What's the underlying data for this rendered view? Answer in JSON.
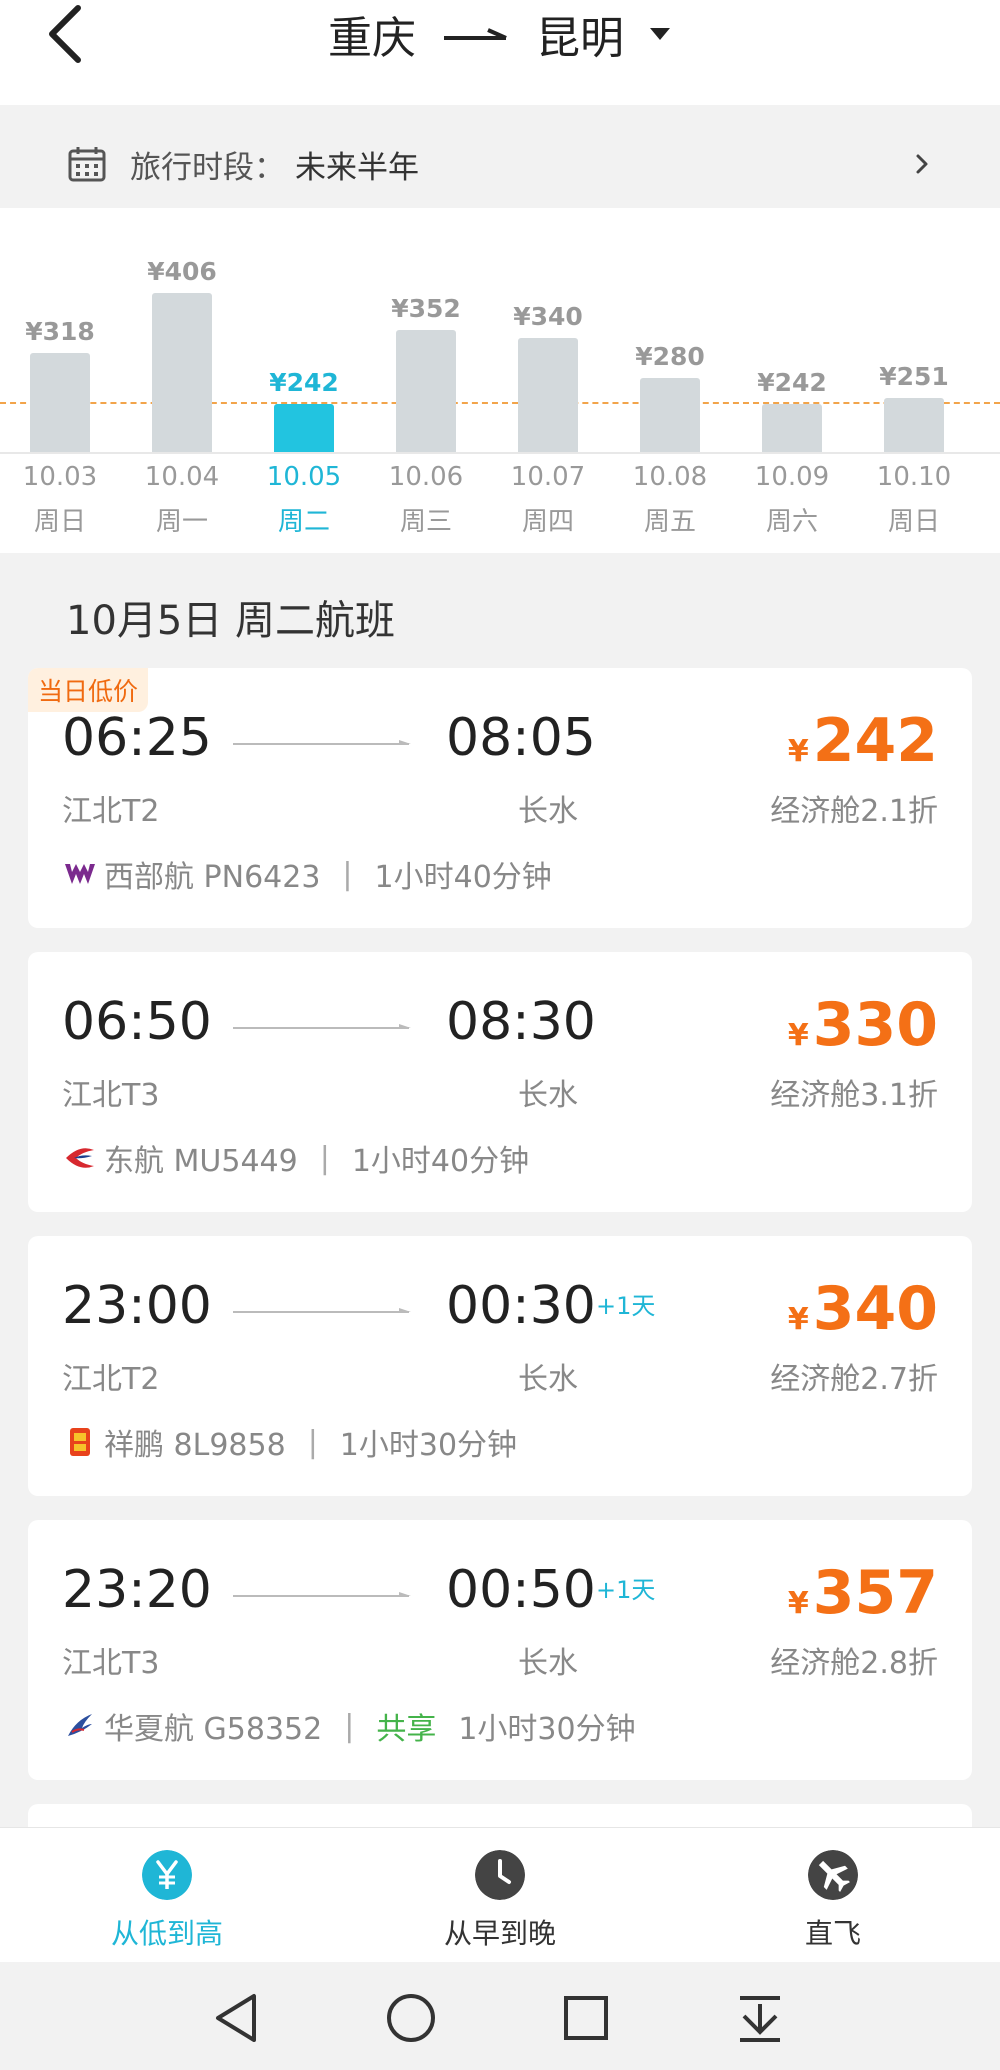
{
  "header": {
    "origin": "重庆",
    "destination": "昆明"
  },
  "period": {
    "label": "旅行时段：",
    "value": "未来半年"
  },
  "price_calendar": [
    {
      "price": "¥318",
      "date": "10.03",
      "weekday": "周日",
      "selected": false,
      "value": 318
    },
    {
      "price": "¥406",
      "date": "10.04",
      "weekday": "周一",
      "selected": false,
      "value": 406
    },
    {
      "price": "¥242",
      "date": "10.05",
      "weekday": "周二",
      "selected": true,
      "value": 242
    },
    {
      "price": "¥352",
      "date": "10.06",
      "weekday": "周三",
      "selected": false,
      "value": 352
    },
    {
      "price": "¥340",
      "date": "10.07",
      "weekday": "周四",
      "selected": false,
      "value": 340
    },
    {
      "price": "¥280",
      "date": "10.08",
      "weekday": "周五",
      "selected": false,
      "value": 280
    },
    {
      "price": "¥242",
      "date": "10.09",
      "weekday": "周六",
      "selected": false,
      "value": 242
    },
    {
      "price": "¥251",
      "date": "10.10",
      "weekday": "周日",
      "selected": false,
      "value": 251
    }
  ],
  "section_title": "10月5日 周二航班",
  "flights": [
    {
      "tag": "当日低价",
      "dep_time": "06:25",
      "arr_time": "08:05",
      "next_day": "",
      "dep_airport": "江北T2",
      "arr_airport": "长水",
      "currency": "¥",
      "price": "242",
      "cabin": "经济舱2.1折",
      "airline": "西部航 PN6423",
      "share": "",
      "duration": "1小时40分钟",
      "logo": "west-air-logo"
    },
    {
      "tag": "",
      "dep_time": "06:50",
      "arr_time": "08:30",
      "next_day": "",
      "dep_airport": "江北T3",
      "arr_airport": "长水",
      "currency": "¥",
      "price": "330",
      "cabin": "经济舱3.1折",
      "airline": "东航 MU5449",
      "share": "",
      "duration": "1小时40分钟",
      "logo": "china-eastern-logo"
    },
    {
      "tag": "",
      "dep_time": "23:00",
      "arr_time": "00:30",
      "next_day": "+1天",
      "dep_airport": "江北T2",
      "arr_airport": "长水",
      "currency": "¥",
      "price": "340",
      "cabin": "经济舱2.7折",
      "airline": "祥鹏 8L9858",
      "share": "",
      "duration": "1小时30分钟",
      "logo": "lucky-air-logo"
    },
    {
      "tag": "",
      "dep_time": "23:20",
      "arr_time": "00:50",
      "next_day": "+1天",
      "dep_airport": "江北T3",
      "arr_airport": "长水",
      "currency": "¥",
      "price": "357",
      "cabin": "经济舱2.8折",
      "airline": "华夏航 G58352",
      "share": "共享",
      "duration": "1小时30分钟",
      "logo": "china-express-logo"
    }
  ],
  "sort_options": [
    {
      "label": "从低到高",
      "icon": "yuan-icon",
      "active": true
    },
    {
      "label": "从早到晚",
      "icon": "clock-icon",
      "active": false
    },
    {
      "label": "直飞",
      "icon": "plane-icon",
      "active": false
    }
  ],
  "colors": {
    "accent": "#1fb6d6",
    "price": "#f47016",
    "bar": "#d3d9dc",
    "bar_selected": "#22c4e0",
    "average_line": "#f2a44a",
    "share": "#44b34a"
  }
}
